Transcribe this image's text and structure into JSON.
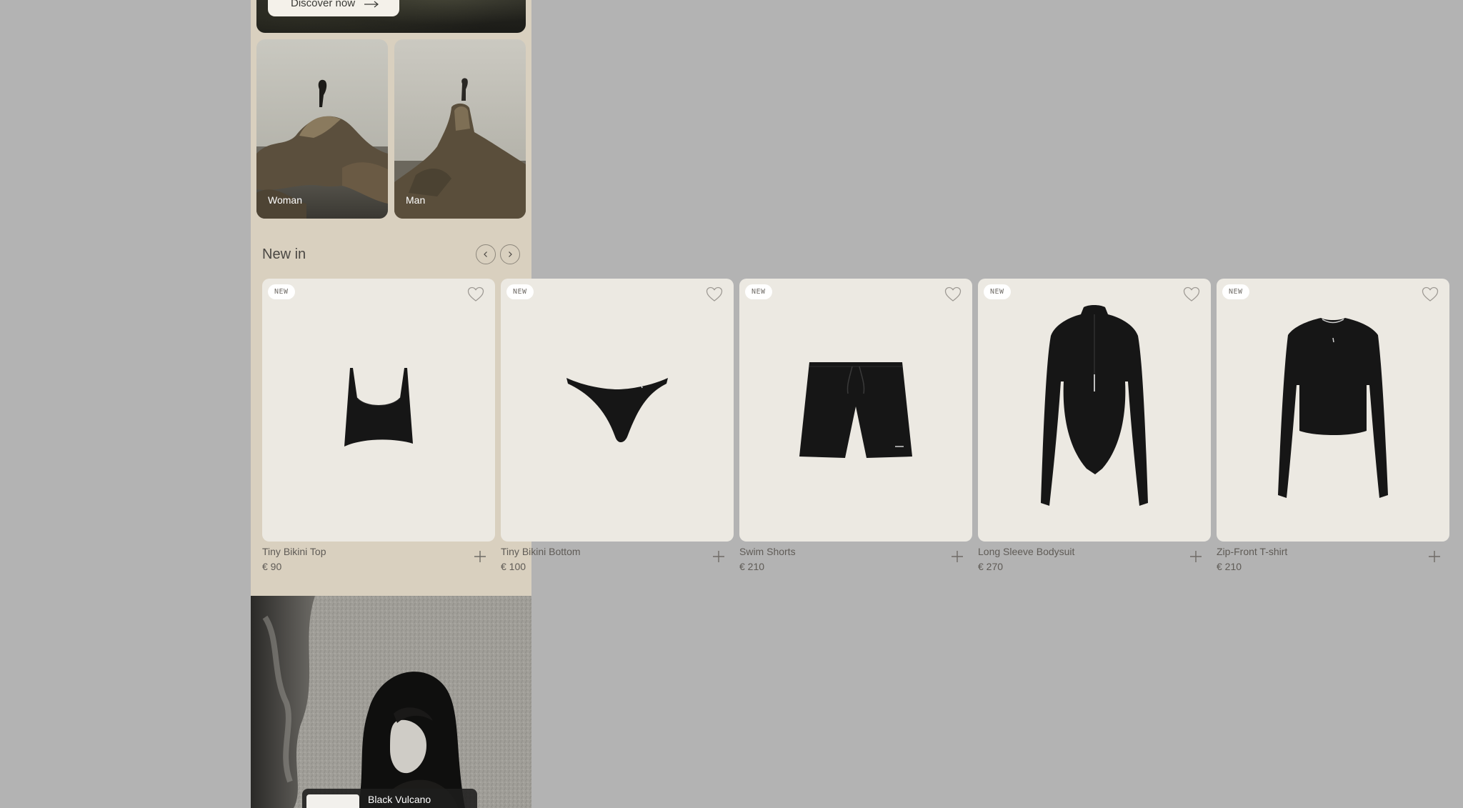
{
  "hero": {
    "cta_label": "Discover now"
  },
  "categories": [
    {
      "label": "Woman"
    },
    {
      "label": "Man"
    }
  ],
  "new_in": {
    "title": "New in",
    "products": [
      {
        "badge": "NEW",
        "name": "Tiny Bikini Top",
        "price": "€ 90",
        "icon": "bikini-top"
      },
      {
        "badge": "NEW",
        "name": "Tiny Bikini Bottom",
        "price": "€ 100",
        "icon": "bikini-bottom"
      },
      {
        "badge": "NEW",
        "name": "Swim Shorts",
        "price": "€ 210",
        "icon": "swim-shorts"
      },
      {
        "badge": "NEW",
        "name": "Long Sleeve Bodysuit",
        "price": "€ 270",
        "icon": "bodysuit"
      },
      {
        "badge": "NEW",
        "name": "Zip-Front T-shirt",
        "price": "€ 210",
        "icon": "zip-tshirt"
      }
    ]
  },
  "feature": {
    "name": "Black Vulcano"
  },
  "colors": {
    "page_bg": "#b3b3b3",
    "panel_bg": "#d9d0bf",
    "card_bg": "#ece9e2",
    "text": "#5f5b56"
  }
}
